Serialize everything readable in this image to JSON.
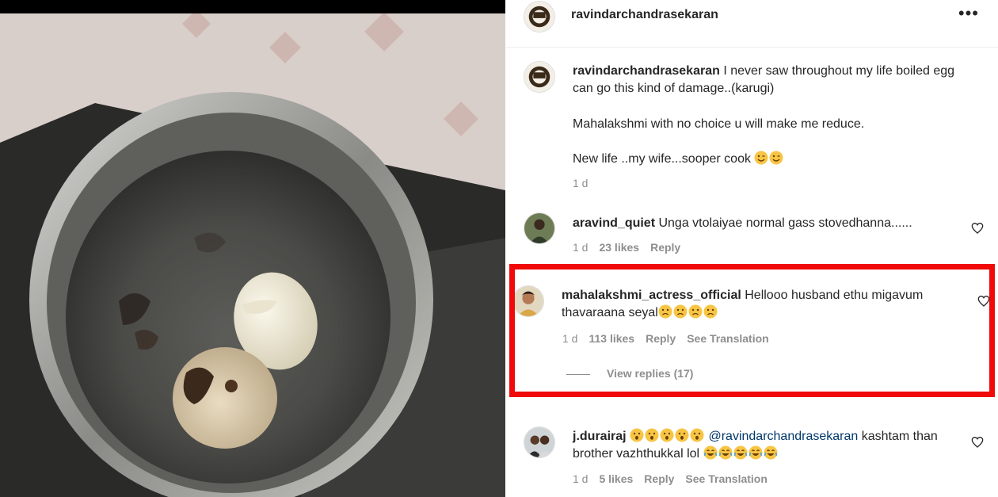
{
  "post": {
    "author": "ravindarchandrasekaran",
    "more_label": "•••",
    "caption": {
      "username": "ravindarchandrasekaran",
      "line1": " I never saw throughout my life boiled egg can go this kind of damage..(karugi)",
      "line2": "Mahalakshmi with no choice u will make me reduce.",
      "line3": "New life ..my wife...sooper cook",
      "line3_emojis": [
        "winking-face",
        "winking-face"
      ],
      "time": "1 d"
    }
  },
  "comments": [
    {
      "username": "aravind_quiet",
      "text": " Unga vtolaiyae normal gass stovedhanna......",
      "time": "1 d",
      "likes": "23 likes",
      "reply": "Reply"
    },
    {
      "username": "mahalakshmi_actress_official",
      "text": " Hellooo husband ethu migavum thavaraana seyal",
      "emojis": [
        "sad-face",
        "sad-face",
        "sad-face",
        "sad-face"
      ],
      "time": "1 d",
      "likes": "113 likes",
      "reply": "Reply",
      "translation": "See Translation",
      "view_replies": "View replies (17)"
    },
    {
      "username": "j.durairaj",
      "lead_emojis": [
        "surprised-face",
        "surprised-face",
        "surprised-face",
        "surprised-face",
        "surprised-face"
      ],
      "mention": "@ravindarchandrasekaran",
      "text": " kashtam than brother vazhthukkal lol",
      "emojis": [
        "laughing-face",
        "laughing-face",
        "laughing-face",
        "laughing-face",
        "laughing-face"
      ],
      "time": "1 d",
      "likes": "5 likes",
      "reply": "Reply",
      "translation": "See Translation"
    }
  ],
  "colors": {
    "highlight_box": "#f00a0a",
    "text": "#262626",
    "muted": "#8e8e8e",
    "mention": "#00376b"
  }
}
